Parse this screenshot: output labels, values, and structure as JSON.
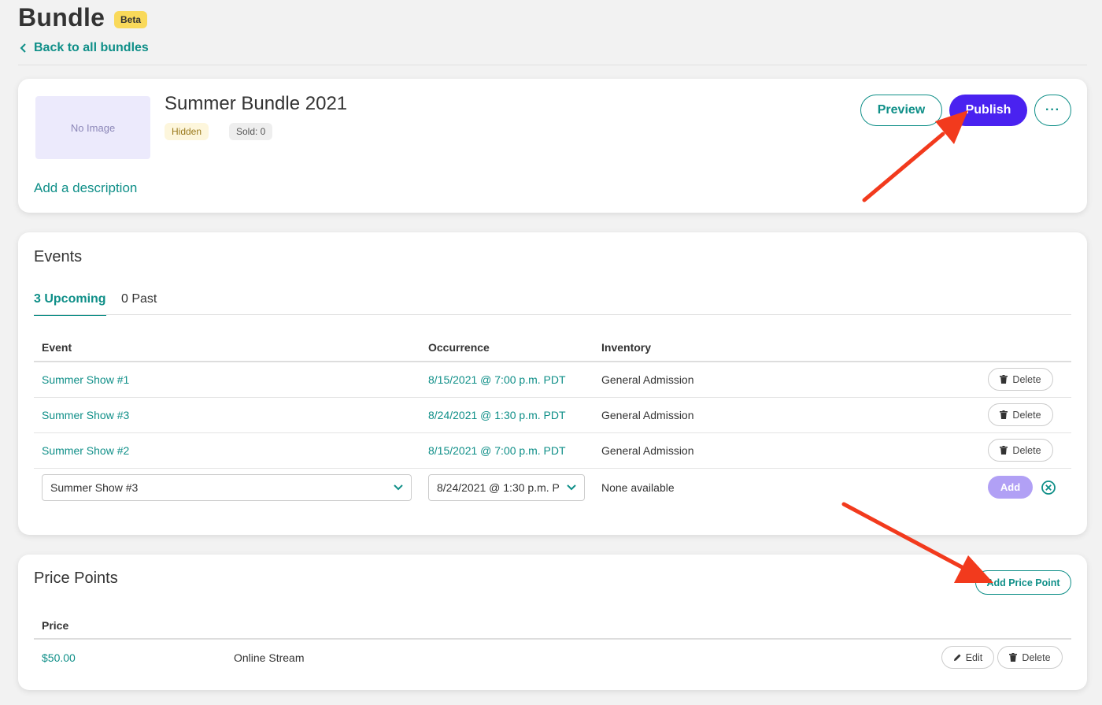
{
  "header": {
    "title": "Bundle",
    "badge": "Beta",
    "back_link": "Back to all bundles"
  },
  "bundle": {
    "image_placeholder": "No Image",
    "name": "Summer Bundle 2021",
    "status_badge": "Hidden",
    "sold_badge": "Sold: 0",
    "add_description": "Add a description",
    "preview_label": "Preview",
    "publish_label": "Publish",
    "more_label": "···"
  },
  "events": {
    "title": "Events",
    "tabs": [
      {
        "label": "3 Upcoming",
        "active": true
      },
      {
        "label": "0 Past",
        "active": false
      }
    ],
    "columns": {
      "event": "Event",
      "occurrence": "Occurrence",
      "inventory": "Inventory"
    },
    "rows": [
      {
        "event": "Summer Show #1",
        "occurrence": "8/15/2021 @ 7:00 p.m. PDT",
        "inventory": "General Admission",
        "delete_label": "Delete"
      },
      {
        "event": "Summer Show #3",
        "occurrence": "8/24/2021 @ 1:30 p.m. PDT",
        "inventory": "General Admission",
        "delete_label": "Delete"
      },
      {
        "event": "Summer Show #2",
        "occurrence": "8/15/2021 @ 7:00 p.m. PDT",
        "inventory": "General Admission",
        "delete_label": "Delete"
      }
    ],
    "new_row": {
      "event_select": "Summer Show #3",
      "occurrence_select": "8/24/2021 @ 1:30 p.m. P",
      "inventory": "None available",
      "add_label": "Add"
    }
  },
  "price_points": {
    "title": "Price Points",
    "add_label": "Add Price Point",
    "columns": {
      "price": "Price"
    },
    "rows": [
      {
        "price": "$50.00",
        "name": "Online Stream",
        "edit_label": "Edit",
        "delete_label": "Delete"
      }
    ]
  },
  "colors": {
    "accent": "#0f8f88",
    "publish": "#4a22f0",
    "add_disabled": "#b1a0f5",
    "annotation_arrow": "#f23a1d"
  }
}
